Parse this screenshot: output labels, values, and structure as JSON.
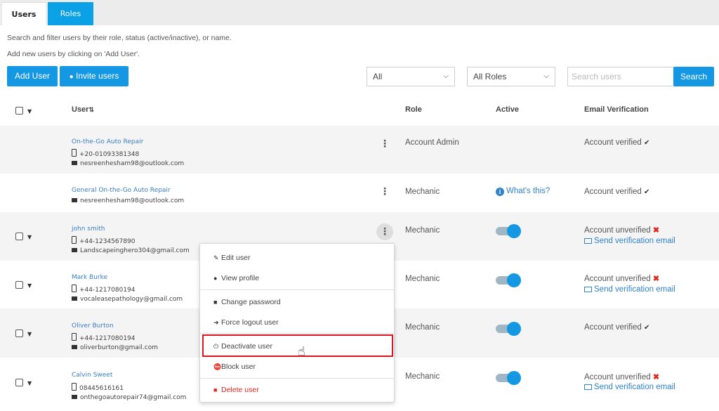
{
  "tabs": {
    "users": "Users",
    "roles": "Roles"
  },
  "help": {
    "line1": "Search and filter users by their role, status (active/inactive), or name.",
    "line2": "Add new users by clicking on 'Add User'."
  },
  "toolbar": {
    "add_user": "Add User",
    "invite_users": "Invite users",
    "status_select": "All",
    "role_select": "All Roles",
    "search_placeholder": "Search users",
    "search_button": "Search"
  },
  "table": {
    "headers": {
      "user": "User",
      "role": "Role",
      "active": "Active",
      "email_verification": "Email Verification"
    },
    "rows": [
      {
        "name": "On-the-Go Auto Repair",
        "phone": "+20-01093381348",
        "email": "nesreenhesham98@outlook.com",
        "role": "Account Admin",
        "verification": "Account verified"
      },
      {
        "name": "General On-the-Go Auto Repair",
        "email": "nesreenhesham98@outlook.com",
        "role": "Mechanic",
        "active_text": "What's this?",
        "verification": "Account verified"
      },
      {
        "name": "john smith",
        "phone": "+44-1234567890",
        "email": "Landscapeinghero304@gmail.com",
        "role": "Mechanic",
        "active": true,
        "verification": "Account unverified",
        "send_link": "Send verification email"
      },
      {
        "name": "Mark Burke",
        "phone": "+44-1217080194",
        "email": "vocaleasepathology@gmail.com",
        "role": "Mechanic",
        "active": true,
        "verification": "Account unverified",
        "send_link": "Send verification email"
      },
      {
        "name": "Oliver Burton",
        "phone": "+44-1217080194",
        "email": "oliverburton@gmail.com",
        "role": "Mechanic",
        "active": true,
        "verification": "Account verified"
      },
      {
        "name": "Calvin Sweet",
        "phone": "08445616161",
        "email": "onthegoautorepair74@gmail.com",
        "role": "Mechanic",
        "active": true,
        "verification": "Account unverified",
        "send_link": "Send verification email"
      }
    ]
  },
  "context_menu": {
    "edit_user": "Edit user",
    "view_profile": "View profile",
    "change_password": "Change password",
    "force_logout": "Force logout user",
    "deactivate_user": "Deactivate user",
    "block_user": "Block user",
    "delete_user": "Delete user"
  },
  "colors": {
    "accent": "#1598e3",
    "link": "#2f83c9",
    "danger": "#e0271c",
    "highlight": "#e0141e"
  }
}
